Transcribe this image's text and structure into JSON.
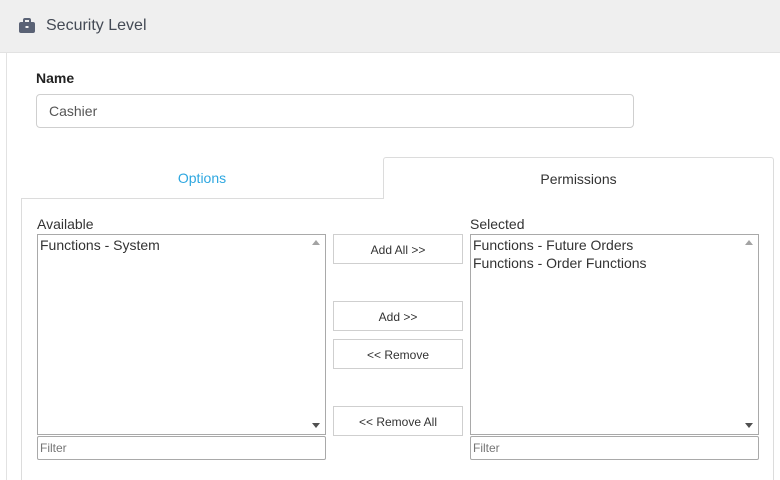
{
  "header": {
    "title": "Security Level",
    "icon": "briefcase-icon",
    "icon_color": "#5a6275"
  },
  "form": {
    "name_label": "Name",
    "name_value": "Cashier"
  },
  "tabs": [
    {
      "label": "Options",
      "active": false
    },
    {
      "label": "Permissions",
      "active": true
    }
  ],
  "permissions": {
    "available_label": "Available",
    "selected_label": "Selected",
    "available_items": [
      "Functions - System"
    ],
    "selected_items": [
      "Functions - Future Orders",
      "Functions - Order Functions"
    ],
    "filter_placeholder": "Filter",
    "buttons": {
      "add_all": "Add All >>",
      "add": "Add >>",
      "remove": "<< Remove",
      "remove_all": "<< Remove All"
    }
  },
  "colors": {
    "link_blue": "#2ea7e0",
    "header_bg": "#efefef"
  }
}
